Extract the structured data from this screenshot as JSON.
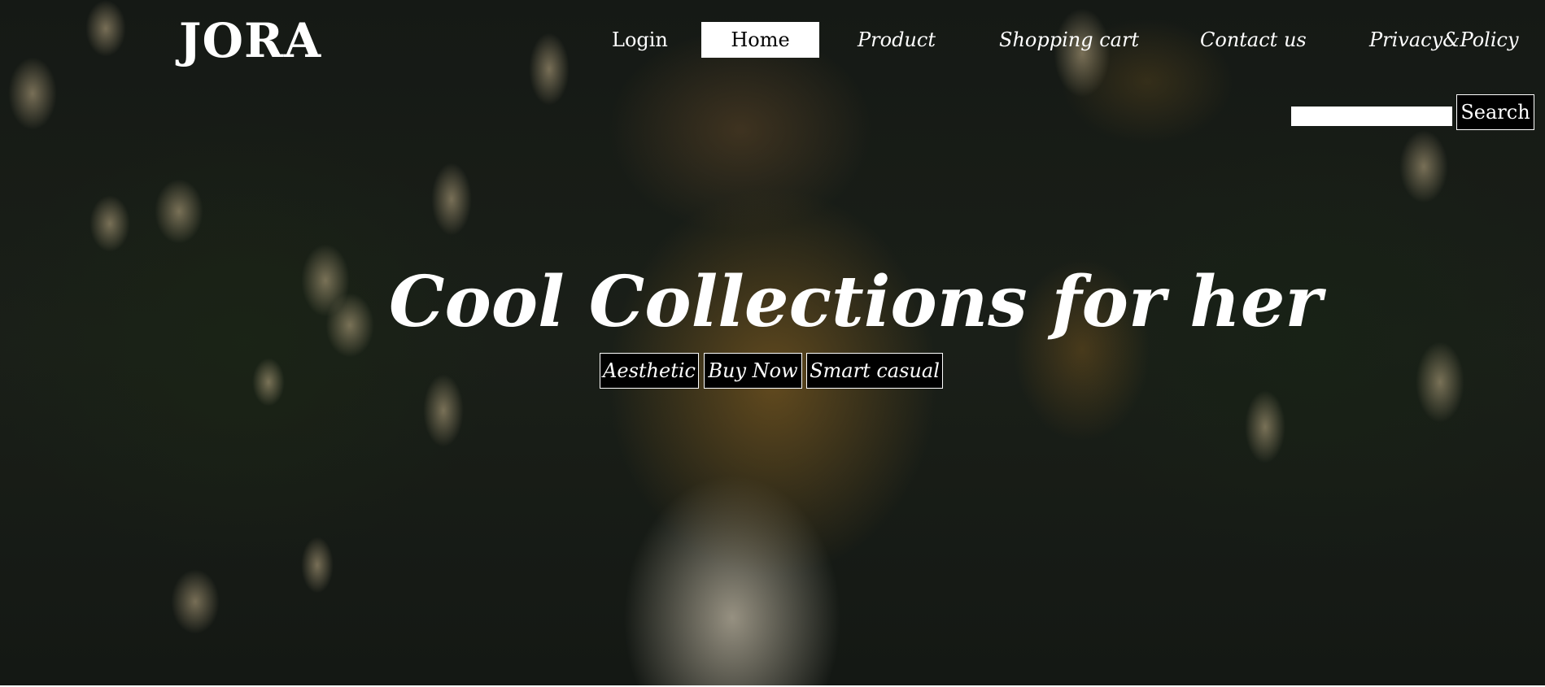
{
  "brand": {
    "logo": "JORA"
  },
  "nav": {
    "items": [
      {
        "label": "Login"
      },
      {
        "label": "Home"
      },
      {
        "label": "Product"
      },
      {
        "label": "Shopping cart"
      },
      {
        "label": "Contact us"
      },
      {
        "label": "Privacy&Policy"
      }
    ],
    "active": "Home"
  },
  "search": {
    "value": "",
    "button_label": "Search"
  },
  "hero": {
    "headline": "Cool Collections for her",
    "tags": [
      {
        "label": "Aesthetic"
      },
      {
        "label": "Buy Now"
      },
      {
        "label": "Smart casual"
      }
    ]
  },
  "colors": {
    "text": "#ffffff",
    "active_nav_bg": "#ffffff",
    "button_bg": "#000000",
    "overlay": "#151915"
  }
}
